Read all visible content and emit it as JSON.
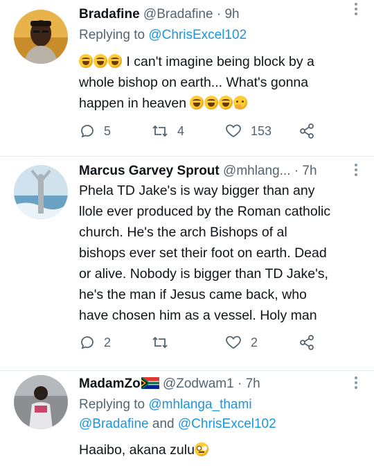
{
  "tweets": [
    {
      "name": "Bradafine",
      "handle": "@Bradafine",
      "dot": "·",
      "time": "9h",
      "replying_prefix": "Replying to",
      "replying_to": "@ChrisExcel102",
      "text_part1": "I can't imagine being block by a",
      "text_part2": "whole bishop on earth... What's gonna",
      "text_part3": "happen in heaven",
      "emojis_leading": "🤣🤣🤣",
      "emojis_trailing": "🤣🤣🤣🤔",
      "replies": "5",
      "retweets": "4",
      "likes": "153"
    },
    {
      "name": "Marcus Garvey Sprout",
      "handle": "@mhlang...",
      "dot": "·",
      "time": "7h",
      "lines": [
        "Phela TD Jake's is way bigger than any",
        "llole ever produced by the Roman catholic",
        "church. He's the arch Bishops of al",
        "bishops ever set their foot on earth. Dead",
        "or alive. Nobody is bigger than TD Jake's,",
        "he's the man if Jesus came back, who",
        "have chosen him as a vessel. Holy man"
      ],
      "replies": "2",
      "retweets": "",
      "likes": "2"
    },
    {
      "name": "MadamZo",
      "flag": "🇿🇦",
      "handle": "@Zodwam1",
      "dot": "·",
      "time": "7h",
      "replying_prefix": "Replying to",
      "replying_to_1": "@mhlanga_thami",
      "replying_to_2": "@Bradafine",
      "replying_and": "and",
      "replying_to_3": "@ChrisExcel102",
      "text": "Haaibo, akana zulu",
      "emoji_trailing": "🙄"
    }
  ],
  "colors": {
    "link": "#1b95e0",
    "secondary": "#536471",
    "divider": "#e1e8ed"
  }
}
